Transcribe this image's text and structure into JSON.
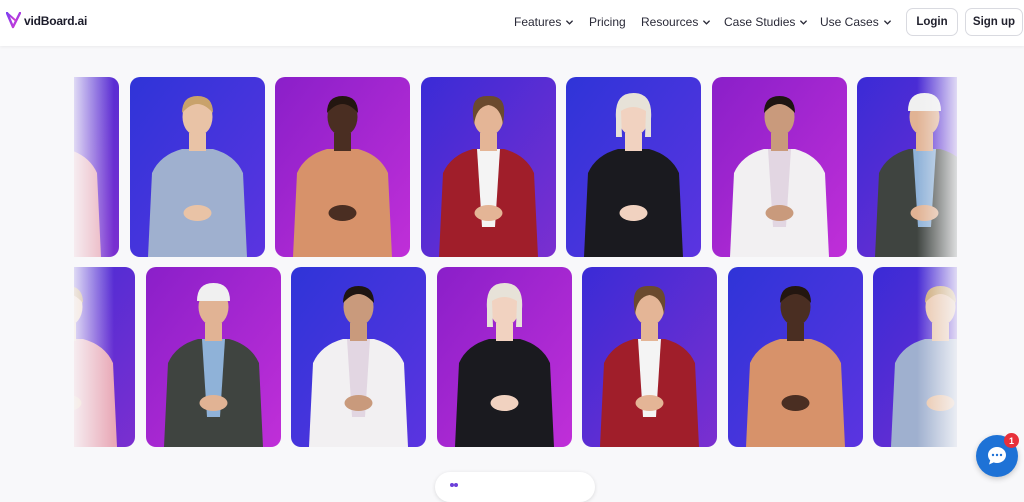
{
  "brand": {
    "name": "vidBoard.ai",
    "accent": "#6b3fd9"
  },
  "nav": {
    "menu": [
      {
        "label": "Features",
        "dropdown": true
      },
      {
        "label": "Pricing",
        "dropdown": false
      },
      {
        "label": "Resources",
        "dropdown": true
      },
      {
        "label": "Case Studies",
        "dropdown": true
      },
      {
        "label": "Use Cases",
        "dropdown": true
      }
    ],
    "login_label": "Login",
    "signup_label": "Sign up"
  },
  "gallery": {
    "row1": [
      {
        "avatar": "woman-pink-blazer",
        "background": "purple"
      },
      {
        "avatar": "woman-blue-sweater",
        "background": "blue"
      },
      {
        "avatar": "man-orange-sweater",
        "background": "magenta"
      },
      {
        "avatar": "man-red-blazer",
        "background": "purple"
      },
      {
        "avatar": "woman-black-leather-jacket",
        "background": "blue"
      },
      {
        "avatar": "woman-white-blazer",
        "background": "magenta"
      },
      {
        "avatar": "man-worker-overalls",
        "background": "purple"
      }
    ],
    "row2": [
      {
        "avatar": "woman-pink-blazer",
        "background": "purple"
      },
      {
        "avatar": "man-worker-overalls",
        "background": "magenta"
      },
      {
        "avatar": "woman-white-blazer",
        "background": "blue"
      },
      {
        "avatar": "woman-black-leather-jacket",
        "background": "magenta"
      },
      {
        "avatar": "man-red-blazer",
        "background": "purple"
      },
      {
        "avatar": "man-orange-sweater",
        "background": "blue"
      },
      {
        "avatar": "woman-blue-sweater",
        "background": "purple"
      }
    ]
  },
  "avatars_badge": {
    "text": ""
  },
  "chat": {
    "unread_count": "1",
    "color": "#1e72d6"
  }
}
